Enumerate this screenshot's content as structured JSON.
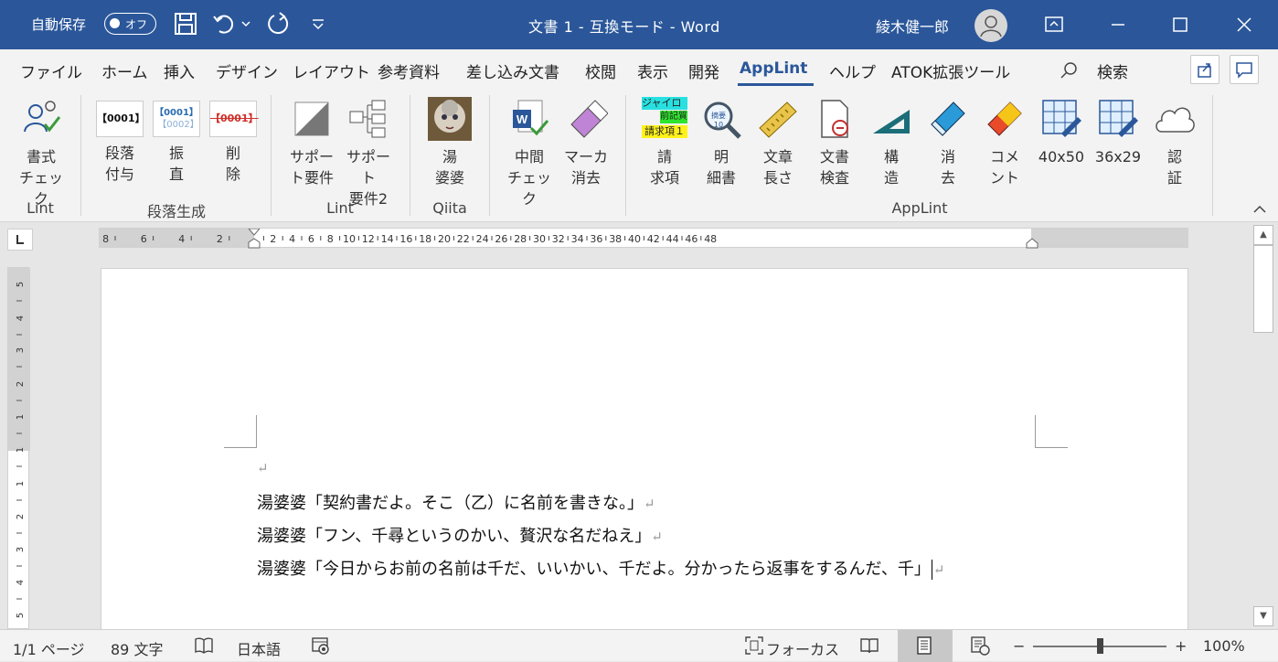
{
  "titlebar": {
    "autosave_label": "自動保存",
    "autosave_state": "オフ",
    "document_title": "文書 1  -  互換モード  -  Word",
    "user_name": "綾木健一郎",
    "accent": "#2b579a"
  },
  "tabs": {
    "items": [
      "ファイル",
      "ホーム",
      "挿入",
      "デザイン",
      "レイアウト",
      "参考資料",
      "差し込み文書",
      "校閲",
      "表示",
      "開発",
      "AppLint",
      "ヘルプ",
      "ATOK拡張ツール"
    ],
    "active": "AppLint",
    "search_label": "検索"
  },
  "ribbon": {
    "buttons": {
      "shoshiki": "書式\nチェック",
      "danraku_fuyo": "段落\n付与",
      "furi_nao": "振\n直",
      "sakujo": "削\n除",
      "support1": "サポー\nト要件",
      "support2": "サポート\n要件2",
      "yubaba": "湯\n婆婆",
      "chukan": "中間\nチェック",
      "marker": "マーカ\n消去",
      "seikyu": "請\n求項",
      "meisai": "明\n細書",
      "nagasa": "文章\n長さ",
      "kensa": "文書\n検査",
      "kozo": "構\n造",
      "kesu": "消\n去",
      "comment": "コメ\nント",
      "g40x50": "40x50",
      "g36x29": "36x29",
      "ninsho": "認\n証"
    },
    "icon_text": {
      "para1": "【0001】",
      "para2a": "【0001】",
      "para2b": "【0002】",
      "para3": "【0001】",
      "seikyu_line1": "ジャイロ",
      "seikyu_line2": "前記質",
      "seikyu_line3": "請求項１",
      "meisai_badge": "摘要10"
    },
    "groups": {
      "lint1": "Lint",
      "danraku": "段落生成",
      "lint2": "Lint",
      "qiita": "Qiita",
      "applint": "AppLint"
    }
  },
  "ruler": {
    "left_labels": [
      "8",
      "6",
      "4",
      "2"
    ],
    "right_labels": [
      "2",
      "4",
      "6",
      "8",
      "10",
      "12",
      "14",
      "16",
      "18",
      "20",
      "22",
      "24",
      "26",
      "28",
      "30",
      "32",
      "34",
      "36",
      "38",
      "40",
      "42",
      "44",
      "46",
      "48"
    ]
  },
  "vruler": {
    "labels": [
      "5",
      "4",
      "3",
      "2",
      "1",
      "1",
      "1",
      "2",
      "3",
      "4",
      "5"
    ]
  },
  "document": {
    "lines": [
      "湯婆婆「契約書だよ。そこ（乙）に名前を書きな。」",
      "湯婆婆「フン、千尋というのかい、贅沢な名だねえ」",
      "湯婆婆「今日からお前の名前は千だ、いいかい、千だよ。分かったら返事をするんだ、千」"
    ],
    "paragraph_mark": "↵"
  },
  "statusbar": {
    "page": "1/1 ページ",
    "words": "89 文字",
    "language": "日本語",
    "focus": "フォーカス",
    "zoom_minus": "−",
    "zoom_plus": "+",
    "zoom_level": "100%",
    "zoom_fraction": 0.5
  }
}
